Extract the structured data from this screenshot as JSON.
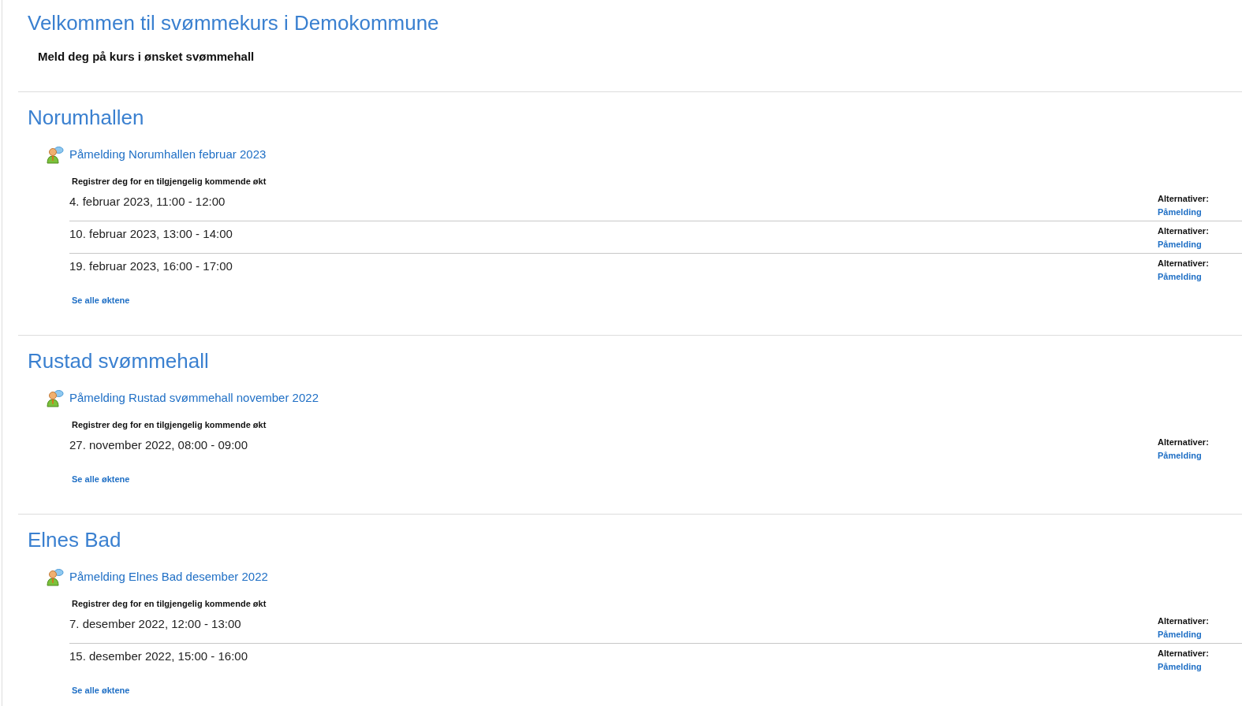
{
  "page": {
    "title": "Velkommen til svømmekurs i Demokommune",
    "subtitle": "Meld deg på kurs i ønsket svømmehall"
  },
  "sections": [
    {
      "name": "Norumhallen",
      "activity": "Påmelding Norumhallen februar 2023",
      "instruction": "Registrer deg for en tilgjengelig kommende økt",
      "sessions": [
        {
          "date": "4. februar 2023, 11:00 - 12:00",
          "options_label": "Alternativer:",
          "action": "Påmelding"
        },
        {
          "date": "10. februar 2023, 13:00 - 14:00",
          "options_label": "Alternativer:",
          "action": "Påmelding"
        },
        {
          "date": "19. februar 2023, 16:00 - 17:00",
          "options_label": "Alternativer:",
          "action": "Påmelding"
        }
      ],
      "see_all": "Se alle øktene"
    },
    {
      "name": "Rustad svømmehall",
      "activity": "Påmelding Rustad svømmehall november 2022",
      "instruction": "Registrer deg for en tilgjengelig kommende økt",
      "sessions": [
        {
          "date": "27. november 2022, 08:00 - 09:00",
          "options_label": "Alternativer:",
          "action": "Påmelding"
        }
      ],
      "see_all": "Se alle øktene"
    },
    {
      "name": "Elnes Bad",
      "activity": "Påmelding Elnes Bad desember 2022",
      "instruction": "Registrer deg for en tilgjengelig kommende økt",
      "sessions": [
        {
          "date": "7. desember 2022, 12:00 - 13:00",
          "options_label": "Alternativer:",
          "action": "Påmelding"
        },
        {
          "date": "15. desember 2022, 15:00 - 16:00",
          "options_label": "Alternativer:",
          "action": "Påmelding"
        }
      ],
      "see_all": "Se alle øktene"
    }
  ]
}
